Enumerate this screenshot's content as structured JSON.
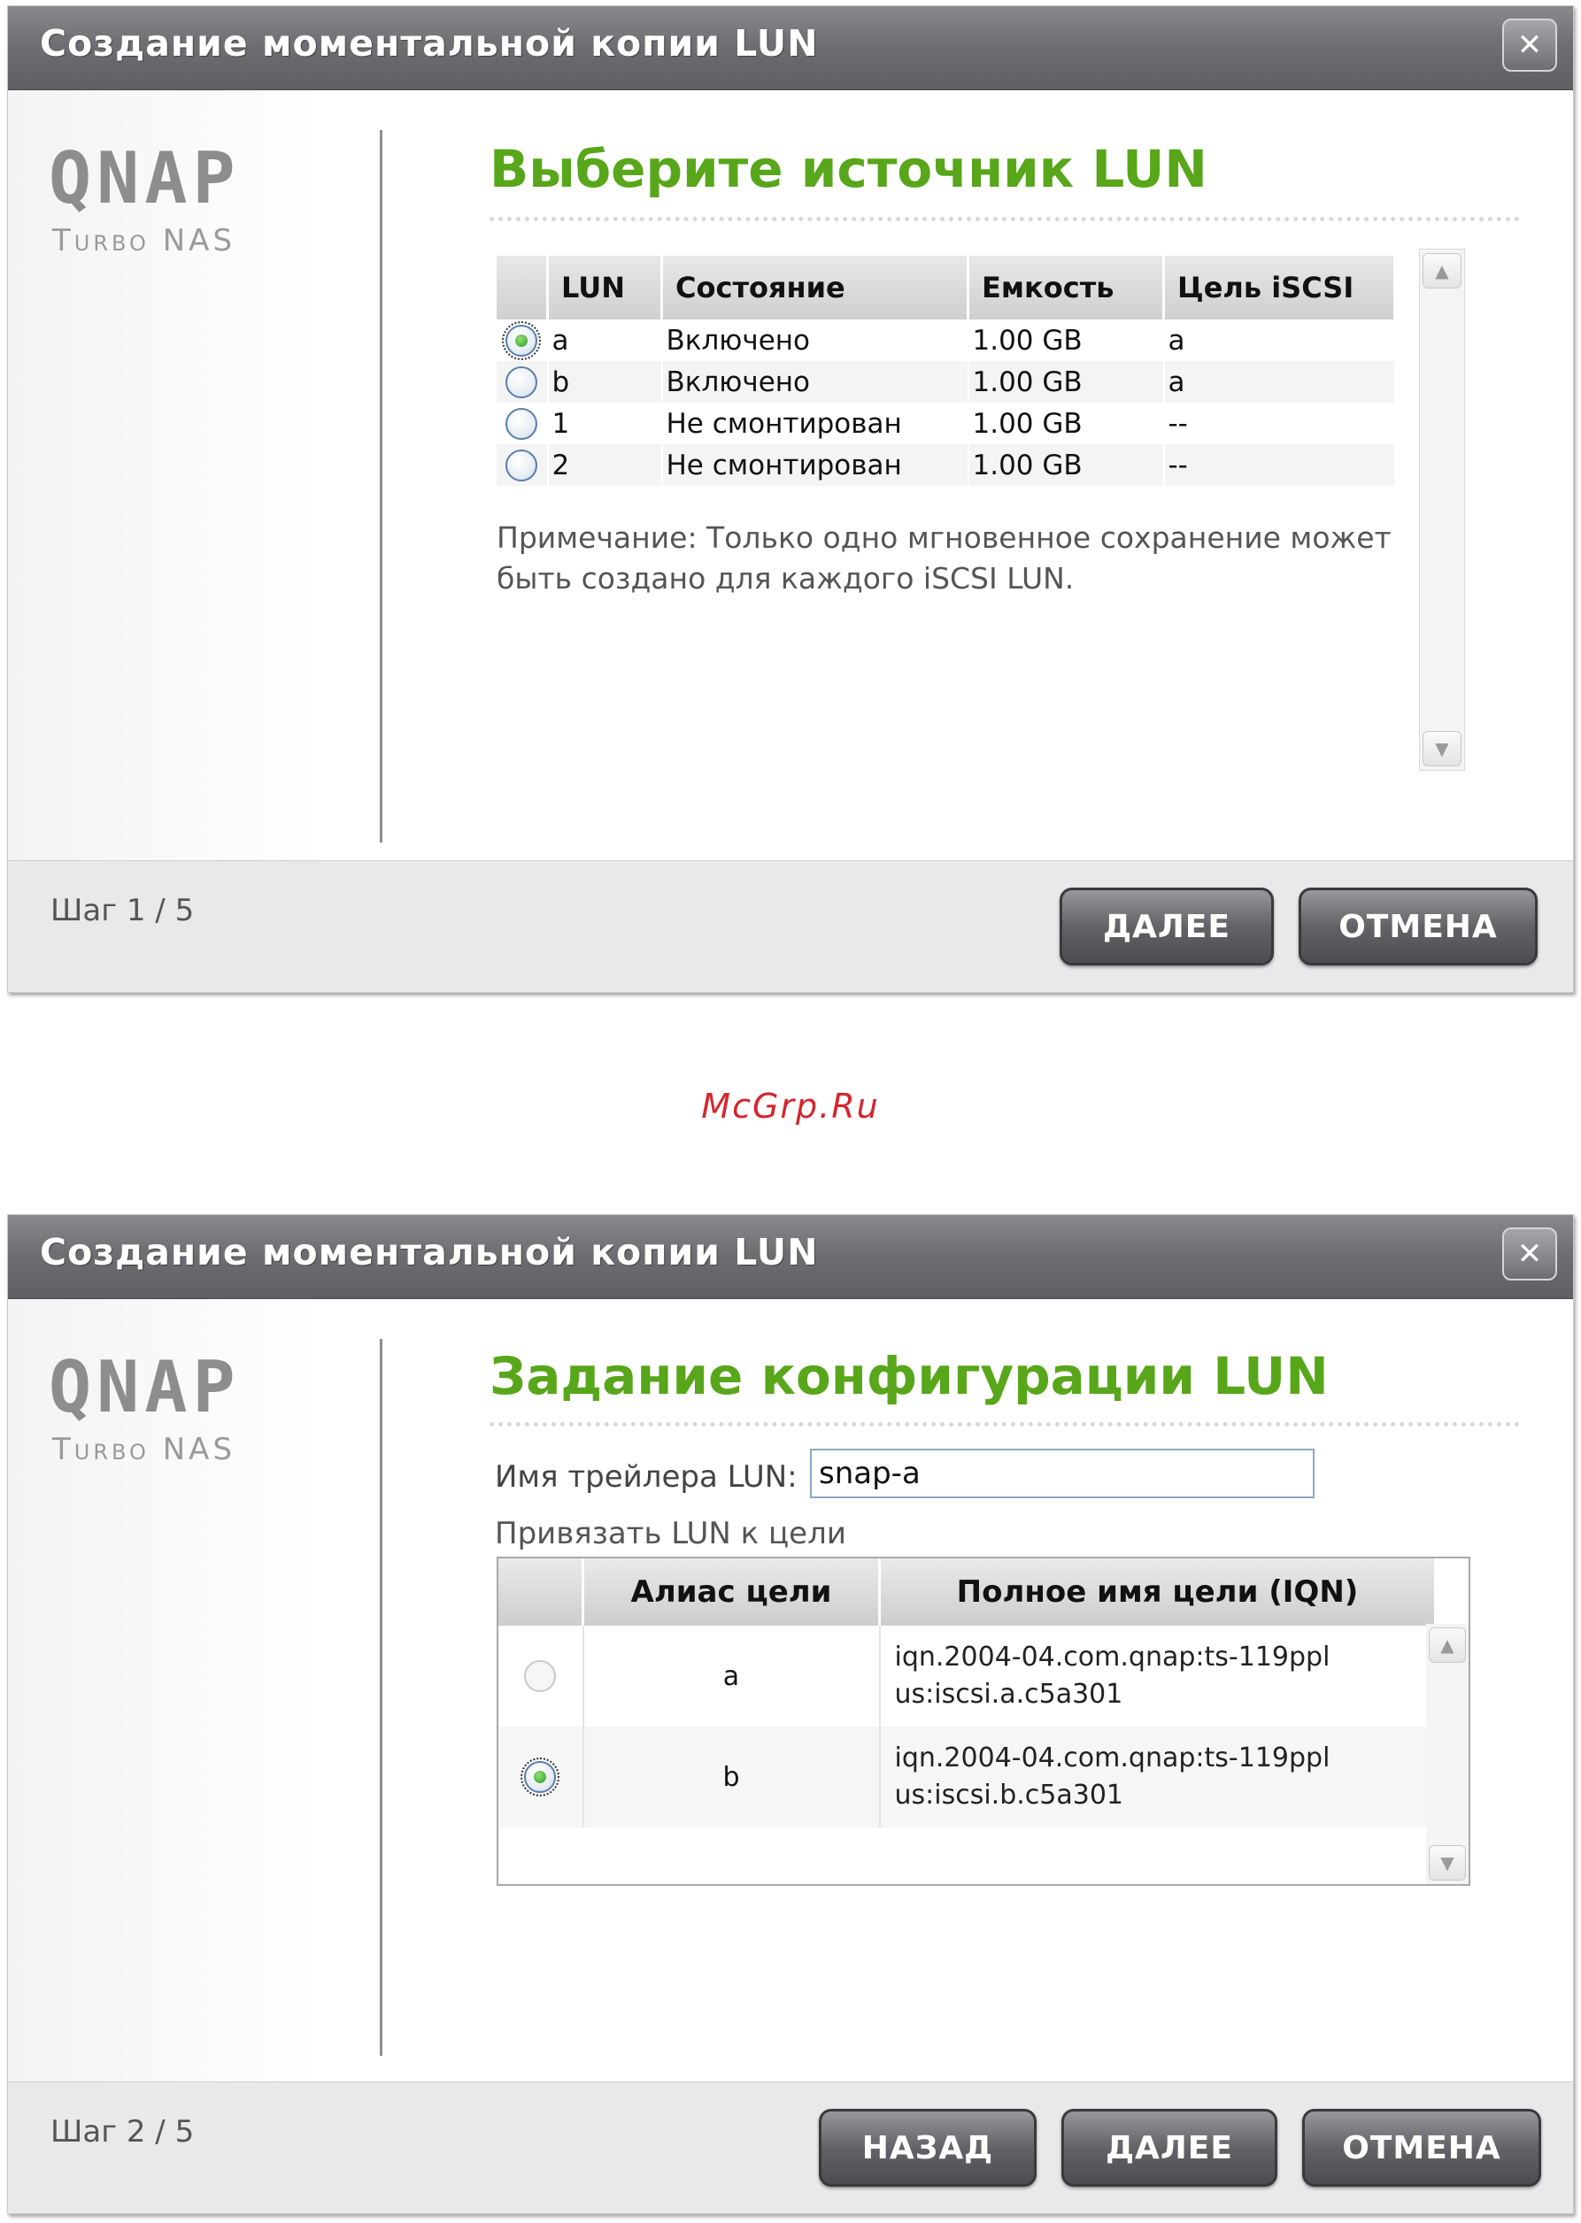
{
  "watermark": "McGrp.Ru",
  "dialog1": {
    "title": "Создание моментальной копии LUN",
    "close_glyph": "✕",
    "logo_main": "QNAP",
    "logo_sub": "Turbo NAS",
    "heading": "Выберите источник LUN",
    "columns": [
      "",
      "LUN",
      "Состояние",
      "Емкость",
      "Цель iSCSI"
    ],
    "rows": [
      {
        "lun": "a",
        "state": "Включено",
        "capacity": "1.00 GB",
        "target": "a",
        "selected": true
      },
      {
        "lun": "b",
        "state": "Включено",
        "capacity": "1.00 GB",
        "target": "a",
        "selected": false
      },
      {
        "lun": "1",
        "state": "Не смонтирован",
        "capacity": "1.00 GB",
        "target": "--",
        "selected": false
      },
      {
        "lun": "2",
        "state": "Не смонтирован",
        "capacity": "1.00 GB",
        "target": "--",
        "selected": false
      }
    ],
    "note": "Примечание: Только одно мгновенное сохранение может быть создано для каждого iSCSI LUN.",
    "step": "Шаг 1 / 5",
    "next_label": "ДАЛЕЕ",
    "cancel_label": "ОТМЕНА"
  },
  "dialog2": {
    "title": "Создание моментальной копии LUN",
    "close_glyph": "✕",
    "logo_main": "QNAP",
    "logo_sub": "Turbo NAS",
    "heading": "Задание конфигурации LUN",
    "name_label": "Имя трейлера LUN:",
    "name_value": "snap-a",
    "bind_label": "Привязать LUN к цели",
    "columns": [
      "",
      "Алиас цели",
      "Полное имя цели (IQN)"
    ],
    "rows": [
      {
        "alias": "a",
        "iqn_line1": "iqn.2004-04.com.qnap:ts-119ppl",
        "iqn_line2": "us:iscsi.a.c5a301",
        "selected": false
      },
      {
        "alias": "b",
        "iqn_line1": "iqn.2004-04.com.qnap:ts-119ppl",
        "iqn_line2": "us:iscsi.b.c5a301",
        "selected": true
      }
    ],
    "step": "Шаг 2 / 5",
    "back_label": "НАЗАД",
    "next_label": "ДАЛЕЕ",
    "cancel_label": "ОТМЕНА"
  },
  "scroll_up_glyph": "▲",
  "scroll_down_glyph": "▼",
  "colors": {
    "heading_green": "#58a61a",
    "watermark_red": "#d4262e",
    "titlebar": "#6f6f73"
  }
}
